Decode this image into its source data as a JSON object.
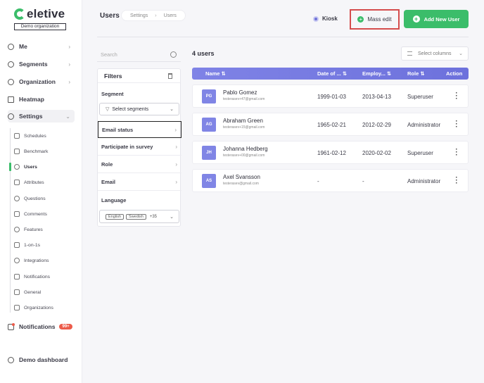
{
  "app": {
    "logo_text": "eletive",
    "org_label": "Demo organization"
  },
  "sidebar": {
    "items": [
      {
        "label": "Me"
      },
      {
        "label": "Segments"
      },
      {
        "label": "Organization"
      },
      {
        "label": "Heatmap"
      },
      {
        "label": "Settings"
      }
    ],
    "settings_subitems": [
      {
        "label": "Schedules"
      },
      {
        "label": "Benchmark"
      },
      {
        "label": "Users"
      },
      {
        "label": "Attributes"
      },
      {
        "label": "Questions"
      },
      {
        "label": "Comments"
      },
      {
        "label": "Features"
      },
      {
        "label": "1-on-1s"
      },
      {
        "label": "Integrations"
      },
      {
        "label": "Notifications"
      },
      {
        "label": "General"
      },
      {
        "label": "Organizations"
      }
    ],
    "notifications": {
      "label": "Notifications",
      "badge": "99+"
    },
    "demo_dashboard": "Demo dashboard"
  },
  "header": {
    "title": "Users",
    "breadcrumb": [
      "Settings",
      "Users"
    ],
    "kiosk_label": "Kiosk",
    "mass_edit_label": "Mass edit",
    "add_user_label": "Add New User"
  },
  "filters": {
    "search_placeholder": "Search",
    "title": "Filters",
    "segment_label": "Segment",
    "segment_select": "Select segments",
    "rows": [
      "Email status",
      "Participate in survey",
      "Role",
      "Email"
    ],
    "language_label": "Language",
    "language_tags": [
      "English",
      "Swedish"
    ],
    "language_more": "+35"
  },
  "table": {
    "count": "4 users",
    "select_columns": "Select columns",
    "headers": [
      "Name",
      "Date of ...",
      "Employ...",
      "Role",
      "Action"
    ],
    "rows": [
      {
        "initials": "PG",
        "name": "Pablo Gomez",
        "email": "testerasev+47@gmail.com",
        "dob": "1999-01-03",
        "employed": "2013-04-13",
        "role": "Superuser"
      },
      {
        "initials": "AG",
        "name": "Abraham Green",
        "email": "testerasev+15@gmail.com",
        "dob": "1965-02-21",
        "employed": "2012-02-29",
        "role": "Administrator"
      },
      {
        "initials": "JH",
        "name": "Johanna Hedberg",
        "email": "testerasev+00@gmail.com",
        "dob": "1961-02-12",
        "employed": "2020-02-02",
        "role": "Superuser"
      },
      {
        "initials": "AS",
        "name": "Axel Svansson",
        "email": "testerasev@gmail.com",
        "dob": "-",
        "employed": "-",
        "role": "Administrator"
      }
    ]
  },
  "colors": {
    "accent": "#3bbd6a",
    "header": "#7f83e6",
    "highlight": "#d54d4d"
  }
}
